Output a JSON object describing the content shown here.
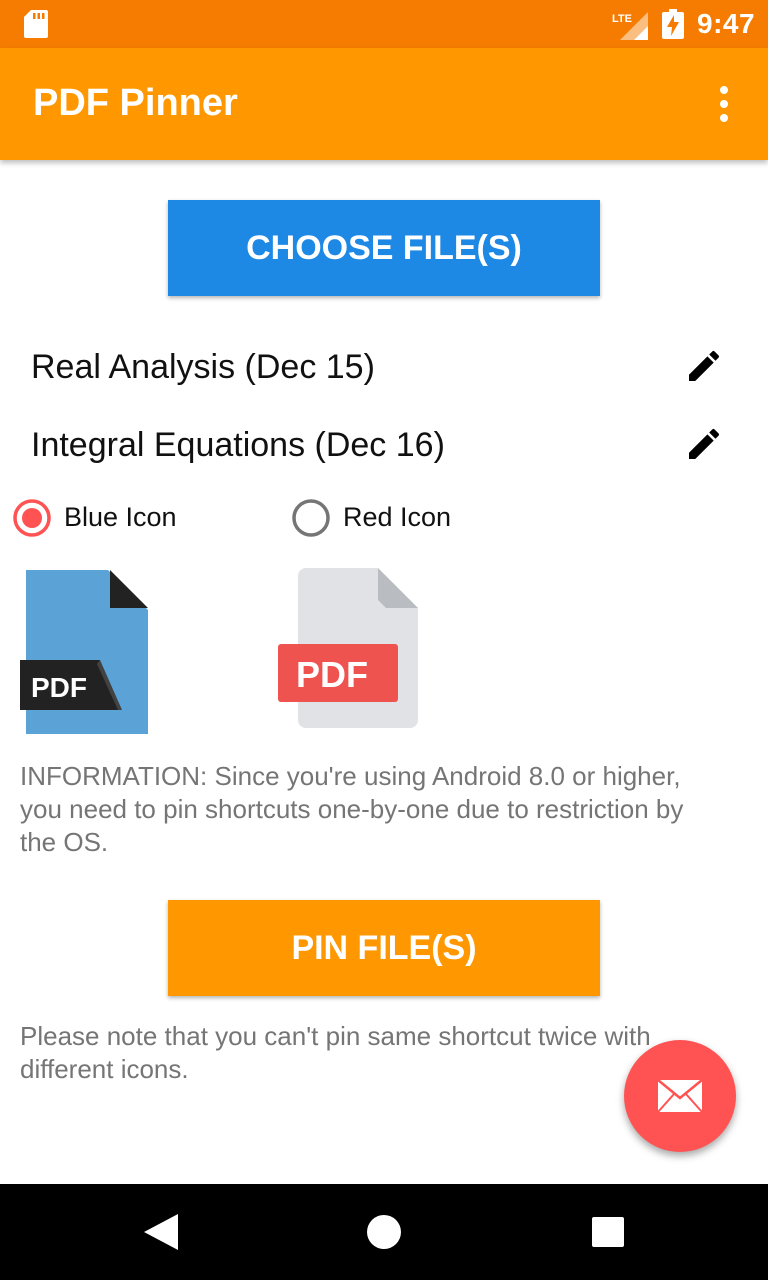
{
  "status_bar": {
    "time": "9:47",
    "network": "LTE",
    "icons": [
      "sd-card-icon",
      "lte-signal-icon",
      "battery-charging-icon"
    ]
  },
  "app_bar": {
    "title": "PDF Pinner",
    "menu_icon": "overflow-menu-icon"
  },
  "choose_button": {
    "label": "CHOOSE FILE(S)",
    "color": "#1e88e5"
  },
  "files": [
    {
      "name": "Real Analysis (Dec 15)",
      "action_icon": "edit-icon"
    },
    {
      "name": "Integral Equations (Dec 16)",
      "action_icon": "edit-icon"
    }
  ],
  "icon_options": [
    {
      "label": "Blue Icon",
      "selected": true
    },
    {
      "label": "Red Icon",
      "selected": false
    }
  ],
  "icon_previews": [
    {
      "name": "pdf-blue-icon",
      "text": "PDF",
      "color": "#5ba3d6"
    },
    {
      "name": "pdf-red-icon",
      "text": "PDF",
      "color": "#ef5350"
    }
  ],
  "info_text": "INFORMATION: Since you're using Android 8.0 or higher, you need to pin shortcuts one-by-one due to restriction by the OS.",
  "pin_button": {
    "label": "PIN FILE(S)",
    "color": "#ff9800"
  },
  "note_text": "Please note that you can't pin same shortcut twice with different icons.",
  "fab": {
    "icon": "mail-icon",
    "color": "#ff5252"
  },
  "nav_bar": {
    "icons": [
      "back-icon",
      "home-icon",
      "recents-icon"
    ]
  },
  "colors": {
    "status_bar": "#f57c00",
    "app_bar": "#ff9800",
    "accent": "#ff5252"
  }
}
